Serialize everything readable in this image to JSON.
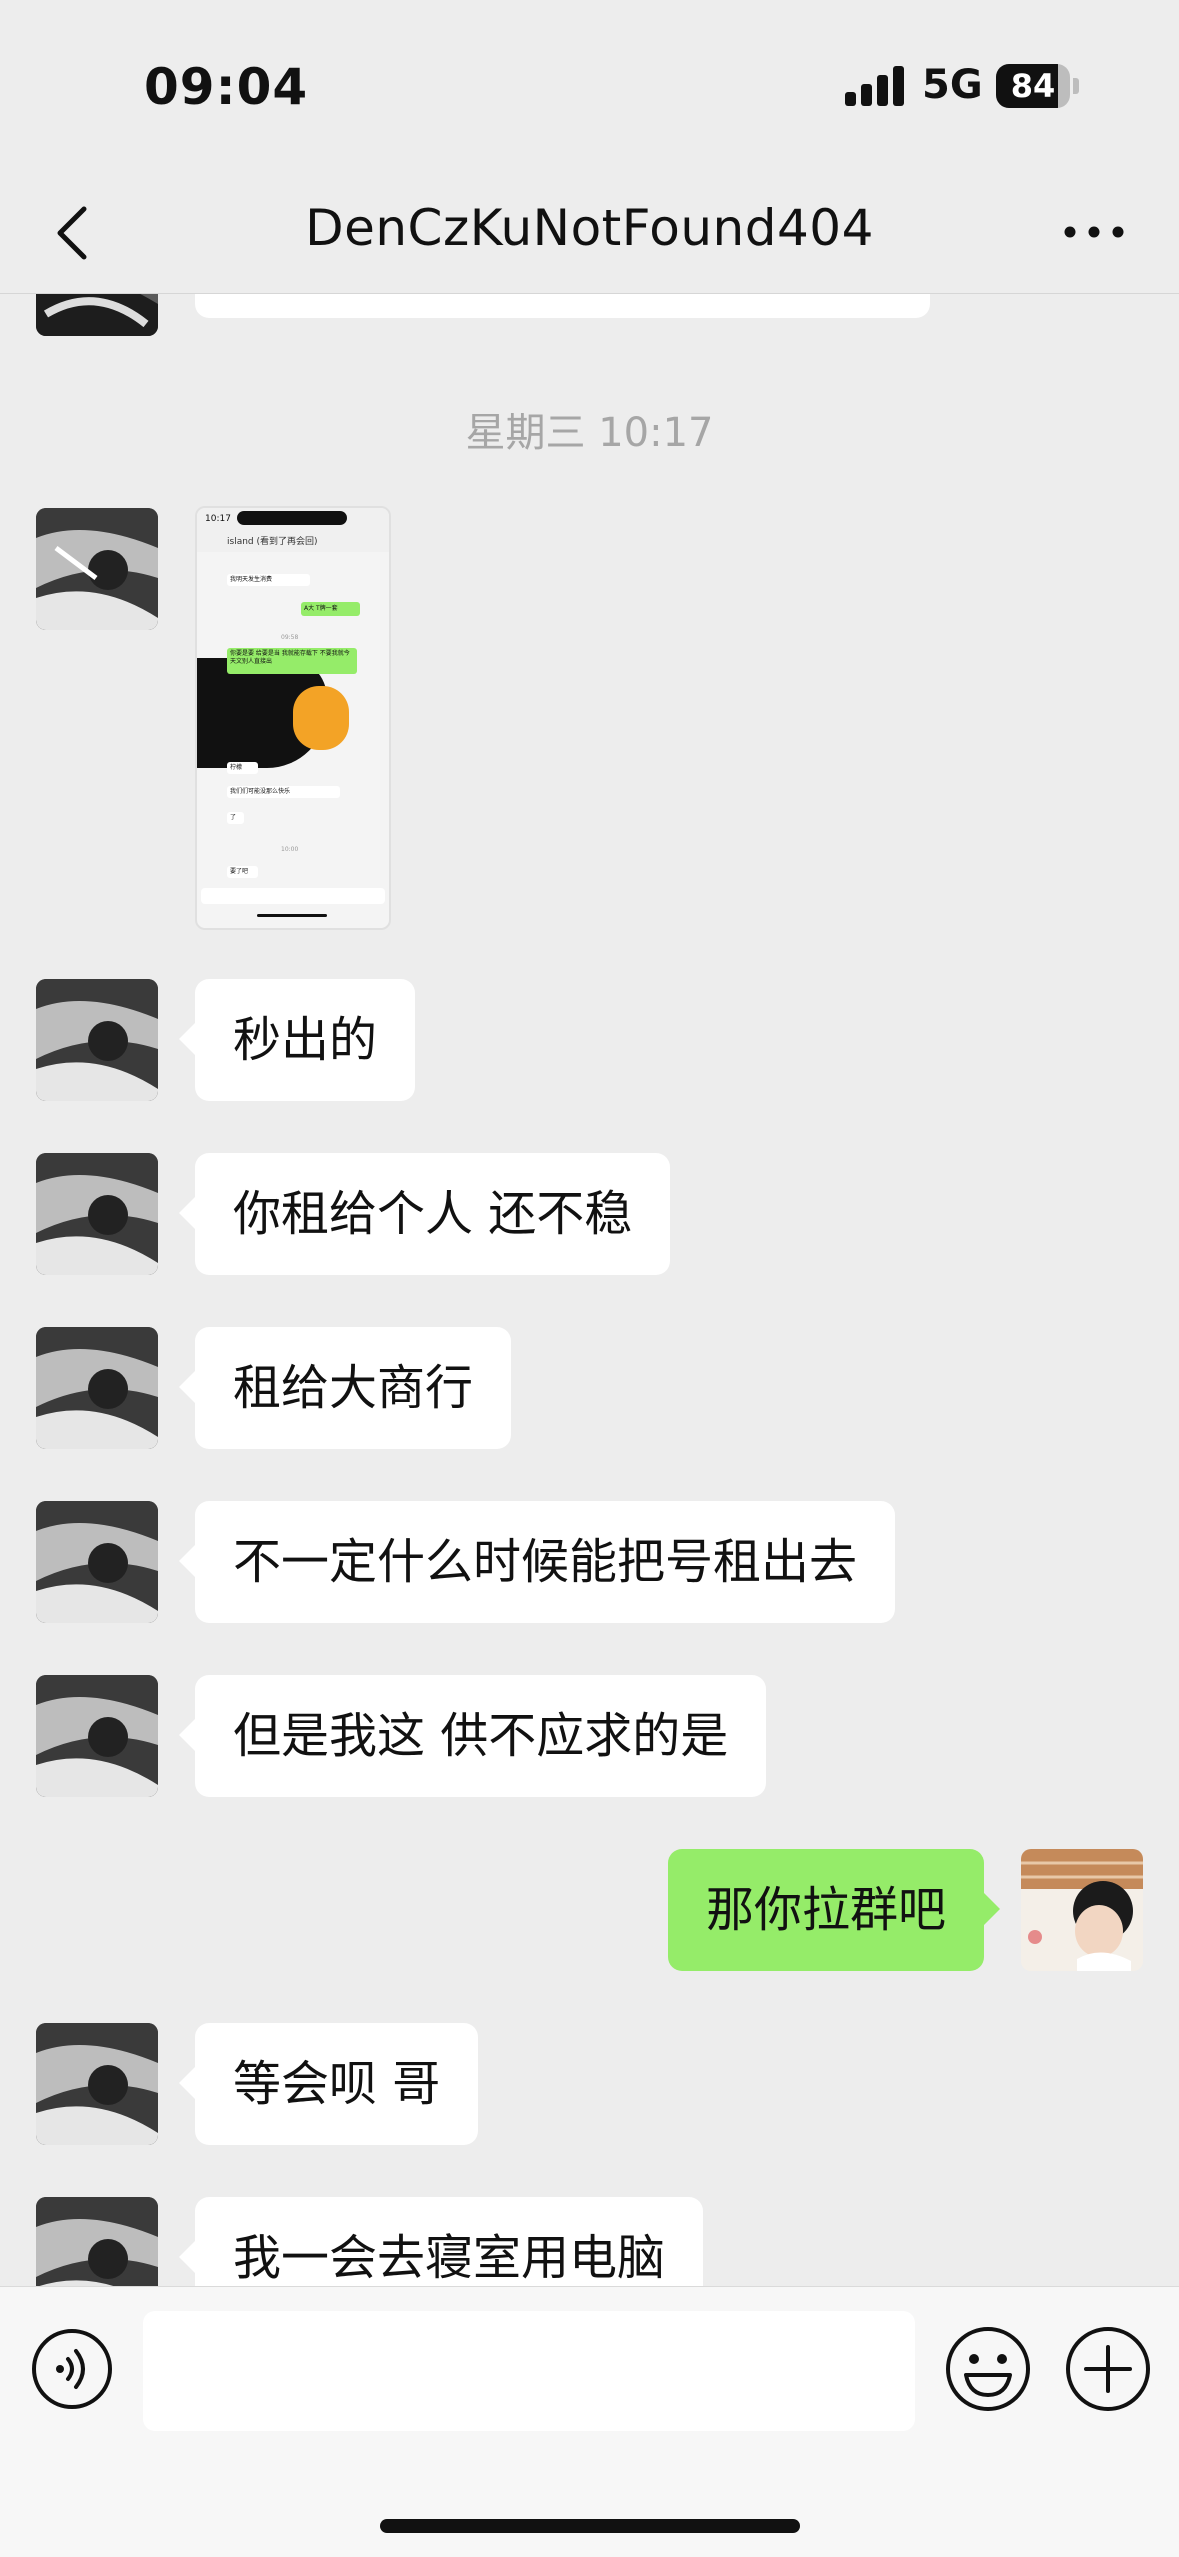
{
  "status_bar": {
    "time": "09:04",
    "network": "5G",
    "battery": "84",
    "battery_level": 0.84
  },
  "nav": {
    "title": "DenCzKuNotFound404"
  },
  "chat": {
    "timestamp": "星期三 10:17",
    "screenshot_preview": {
      "top_time": "10:17",
      "title": "island (看到了再会回)",
      "lines": [
        "我明天发生消费",
        "A大 T牌一套",
        "你要是要 给要是当 我就能存载下 不要我就今天文别人直接出",
        "柠檬",
        "我们们可能没那么快乐",
        "了",
        "要了吧"
      ],
      "mid_time": "09:58",
      "bottom_time": "10:00"
    },
    "messages": [
      {
        "side": "them",
        "text": "秒出的"
      },
      {
        "side": "them",
        "text": "你租给个人 还不稳"
      },
      {
        "side": "them",
        "text": "租给大商行"
      },
      {
        "side": "them",
        "text": "不一定什么时候能把号租出去"
      },
      {
        "side": "them",
        "text": "但是我这 供不应求的是"
      },
      {
        "side": "me",
        "text": "那你拉群吧"
      },
      {
        "side": "them",
        "text": "等会呗 哥"
      },
      {
        "side": "them",
        "text": "我一会去寝室用电脑"
      }
    ]
  },
  "input_bar": {
    "value": "",
    "placeholder": ""
  },
  "icons": {
    "back": "back-chevron-icon",
    "more": "more-dots-icon",
    "voice": "voice-icon",
    "emoji": "emoji-icon",
    "plus": "plus-icon"
  },
  "colors": {
    "my_bubble": "#95ec69",
    "their_bubble": "#ffffff",
    "background": "#ededed"
  }
}
